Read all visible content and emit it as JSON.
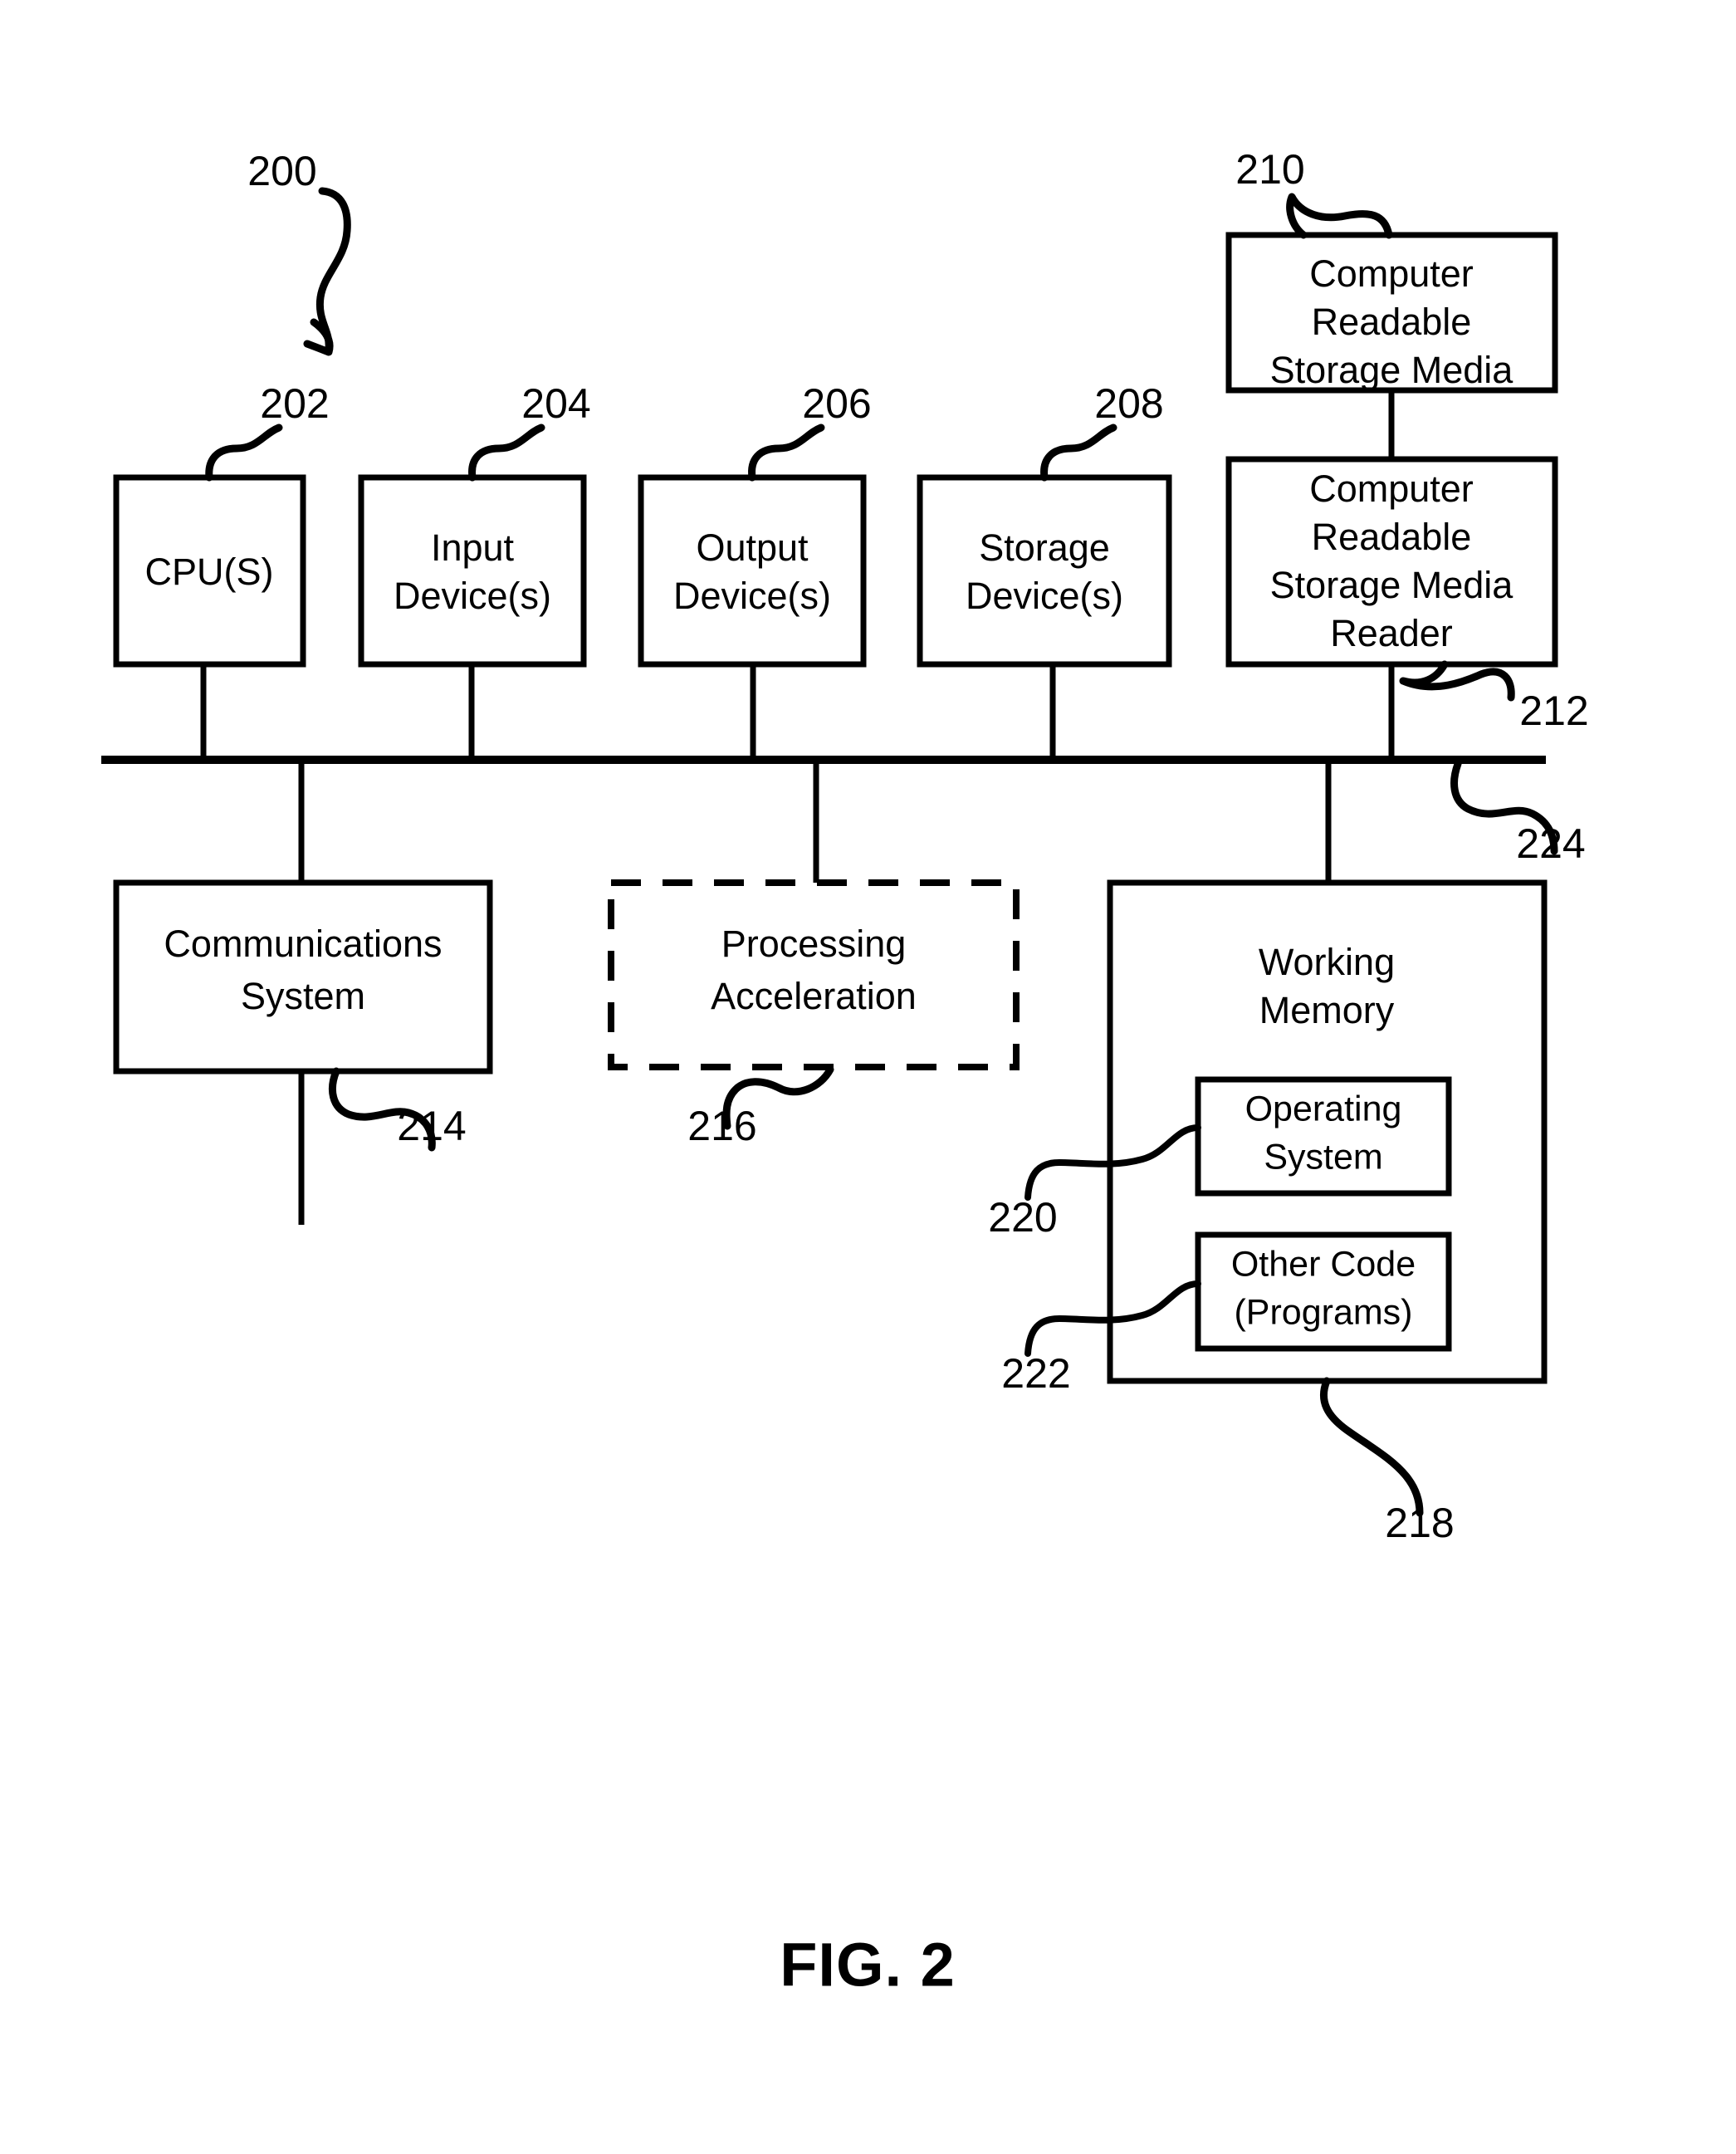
{
  "figure": {
    "caption": "FIG. 2",
    "system_ref": "200"
  },
  "boxes": {
    "cpu": {
      "lines": [
        "CPU(S)"
      ],
      "ref": "202"
    },
    "input_devices": {
      "lines": [
        "Input",
        "Device(s)"
      ],
      "ref": "204"
    },
    "output_devices": {
      "lines": [
        "Output",
        "Device(s)"
      ],
      "ref": "206"
    },
    "storage_devices": {
      "lines": [
        "Storage",
        "Device(s)"
      ],
      "ref": "208"
    },
    "storage_media": {
      "lines": [
        "Computer",
        "Readable",
        "Storage Media"
      ],
      "ref": "210"
    },
    "media_reader": {
      "lines": [
        "Computer",
        "Readable",
        "Storage Media",
        "Reader"
      ],
      "ref": "212"
    },
    "communications_system": {
      "lines": [
        "Communications",
        "System"
      ],
      "ref": "214"
    },
    "processing_acceleration": {
      "lines": [
        "Processing",
        "Acceleration"
      ],
      "ref": "216",
      "style": "dashed"
    },
    "working_memory": {
      "lines": [
        "Working",
        "Memory"
      ],
      "ref": "218"
    },
    "operating_system": {
      "lines": [
        "Operating",
        "System"
      ],
      "ref": "220"
    },
    "other_code": {
      "lines": [
        "Other Code",
        "(Programs)"
      ],
      "ref": "222"
    }
  },
  "bus": {
    "ref": "224"
  },
  "colors": {
    "stroke": "#000000",
    "background": "#ffffff"
  }
}
